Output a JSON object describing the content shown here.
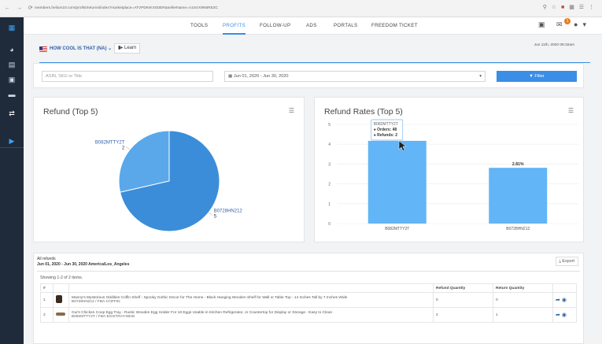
{
  "browser": {
    "url": "members.helium10.com/profits/returns/index?marketplace=ATVPDKIKX0DER&sellerName=A1SVX9N6RE3C"
  },
  "nav": {
    "tabs": [
      {
        "label": "TOOLS",
        "active": false
      },
      {
        "label": "PROFITS",
        "active": true
      },
      {
        "label": "FOLLOW-UP",
        "active": false
      },
      {
        "label": "ADS",
        "active": false
      },
      {
        "label": "PORTALS",
        "active": false
      },
      {
        "label": "FREEDOM TICKET",
        "active": false
      }
    ],
    "notification_count": "1",
    "datestamp": "Jun 11th, 2020 08:32am"
  },
  "marketplace": {
    "name": "HOW COOL IS THAT (NA)",
    "learn_label": "Learn"
  },
  "filters": {
    "search_placeholder": "ASIN, SKU or Title",
    "date_range": "Jun 01, 2020 - Jun 30, 2020",
    "filter_label": "Filter"
  },
  "pie_chart": {
    "title": "Refund (Top 5)"
  },
  "bar_chart": {
    "title": "Refund Rates (Top 5)",
    "tooltip": {
      "title": "B082MTTY2T",
      "orders": "Orders: 48",
      "refunds": "Refunds: 2"
    }
  },
  "chart_data": [
    {
      "type": "pie",
      "title": "Refund (Top 5)",
      "slices": [
        {
          "label": "B082MTTY2T",
          "value": 2,
          "color": "#5aa8ea"
        },
        {
          "label": "B0728HN212",
          "value": 5,
          "color": "#3c8dd9"
        }
      ]
    },
    {
      "type": "bar",
      "title": "Refund Rates (Top 5)",
      "categories": [
        "B082MTTY2T",
        "B0728HN212"
      ],
      "values": [
        4.17,
        2.81
      ],
      "data_labels": [
        "",
        "2.81%"
      ],
      "ylim": [
        0,
        5
      ],
      "yticks": [
        0,
        1,
        2,
        3,
        4,
        5
      ],
      "color": "#62b5f6"
    }
  ],
  "table_section": {
    "title": "All refunds",
    "subtitle": "Jun 01, 2020 - Jun 30, 2020 America/Los_Angeles",
    "export_label": "Export",
    "showing_text": "Showing 1-2 of 2 items.",
    "headers": [
      "#",
      "",
      "",
      "Refund Quantity",
      "Return Quantity",
      ""
    ],
    "rows": [
      {
        "index": "1",
        "title": "Manny's Mysterious Oddities Coffin Shelf - Spooky Gothic Decor for The Home - Black Hanging Wooden Shelf for Wall or Table Top - 14 Inches Tall by 7 Inches Wide",
        "sub": "B0728HN212 / FBA-COFFIN",
        "refund_qty": "5",
        "return_qty": "0",
        "thumb_color": "#3b2a1e"
      },
      {
        "index": "2",
        "title": "Gui's Chicken Coop Egg Tray - Rustic Wooden Egg Holder For 18 Eggs Usable in Kitchen Refrigerator, or Countertop for Display or Storage - Easy to Clean",
        "sub": "B082MTTY2T / FBA-EGGTRAY-NEW",
        "refund_qty": "2",
        "return_qty": "1",
        "thumb_color": "#8a6a48"
      }
    ]
  },
  "colors": {
    "accent": "#3a8ee6",
    "sidebar": "#1f2b3a"
  }
}
